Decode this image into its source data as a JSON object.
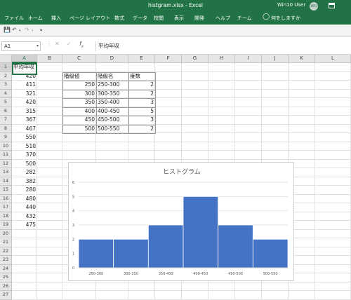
{
  "window": {
    "doc_title": "histgram.xlsx  -  Excel",
    "user_name": "Win10 User",
    "avatar_initials": "WU"
  },
  "ribbon": {
    "tabs": [
      "ファイル",
      "ホーム",
      "挿入",
      "ページ レイアウト",
      "数式",
      "データ",
      "校閲",
      "表示",
      "開発",
      "ヘルプ",
      "チーム"
    ],
    "tell_me": "何をしますか"
  },
  "formula_bar": {
    "name_box": "A1",
    "formula": "平均年収"
  },
  "grid": {
    "columns": [
      "A",
      "B",
      "C",
      "D",
      "E",
      "F",
      "G",
      "H",
      "I",
      "J",
      "K",
      "L"
    ],
    "rows": [
      "1",
      "2",
      "3",
      "4",
      "5",
      "6",
      "7",
      "8",
      "9",
      "10",
      "11",
      "12",
      "13",
      "14",
      "15",
      "16",
      "17",
      "18",
      "19",
      "20",
      "21",
      "22",
      "23",
      "24",
      "25",
      "26",
      "27"
    ]
  },
  "column_a": {
    "header": "平均年収",
    "values": [
      "420",
      "411",
      "321",
      "420",
      "315",
      "367",
      "467",
      "550",
      "510",
      "370",
      "500",
      "282",
      "382",
      "280",
      "480",
      "440",
      "432",
      "475"
    ]
  },
  "freq_table": {
    "headers": [
      "階級値",
      "階級名",
      "度数"
    ],
    "rows": [
      [
        "250",
        "250-300",
        "2"
      ],
      [
        "300",
        "300-350",
        "2"
      ],
      [
        "350",
        "350-400",
        "3"
      ],
      [
        "400",
        "400-450",
        "5"
      ],
      [
        "450",
        "450-500",
        "3"
      ],
      [
        "500",
        "500-550",
        "2"
      ]
    ]
  },
  "chart_data": {
    "type": "bar",
    "title": "ヒストグラム",
    "categories": [
      "250-300",
      "300-350",
      "350-400",
      "400-450",
      "450-500",
      "500-550"
    ],
    "values": [
      2,
      2,
      3,
      5,
      3,
      2
    ],
    "ylim": [
      0,
      6
    ],
    "yticks": [
      "0",
      "1",
      "2",
      "3",
      "4",
      "5",
      "6"
    ],
    "bar_color": "#4472C4",
    "grid": true,
    "xlabel": "",
    "ylabel": ""
  }
}
